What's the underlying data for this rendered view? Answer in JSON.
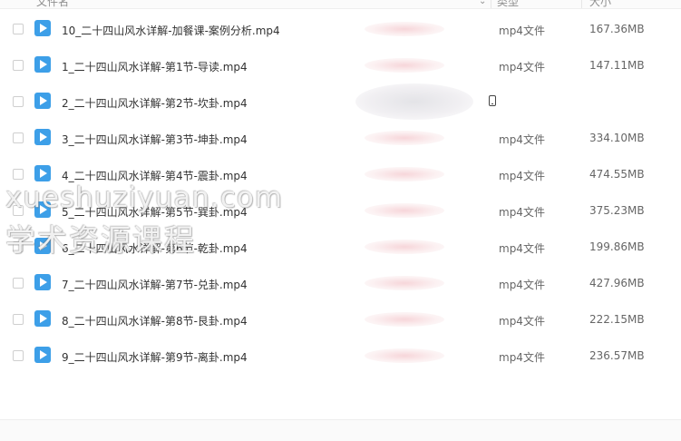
{
  "header": {
    "name_col": "文件名",
    "type_col": "类型",
    "size_col": "大小"
  },
  "files": [
    {
      "name": "10_二十四山风水详解-加餐课-案例分析.mp4",
      "type": "mp4文件",
      "size": "167.36MB"
    },
    {
      "name": "1_二十四山风水详解-第1节-导读.mp4",
      "type": "mp4文件",
      "size": "147.11MB"
    },
    {
      "name": "2_二十四山风水详解-第2节-坎卦.mp4",
      "type": "",
      "size": ""
    },
    {
      "name": "3_二十四山风水详解-第3节-坤卦.mp4",
      "type": "mp4文件",
      "size": "334.10MB"
    },
    {
      "name": "4_二十四山风水详解-第4节-震卦.mp4",
      "type": "mp4文件",
      "size": "474.55MB"
    },
    {
      "name": "5_二十四山风水详解-第5节-巽卦.mp4",
      "type": "mp4文件",
      "size": "375.23MB"
    },
    {
      "name": "6_二十四山风水详解-第6节-乾卦.mp4",
      "type": "mp4文件",
      "size": "199.86MB"
    },
    {
      "name": "7_二十四山风水详解-第7节-兑卦.mp4",
      "type": "mp4文件",
      "size": "427.96MB"
    },
    {
      "name": "8_二十四山风水详解-第8节-艮卦.mp4",
      "type": "mp4文件",
      "size": "222.15MB"
    },
    {
      "name": "9_二十四山风水详解-第9节-离卦.mp4",
      "type": "mp4文件",
      "size": "236.57MB"
    }
  ],
  "watermark": {
    "line1": "xueshuziyuan.com",
    "line2": "学术资源课程"
  },
  "icons": {
    "file": "video-file-icon",
    "row_action": "phone-icon",
    "sort": "chevron-down-icon"
  },
  "colors": {
    "file_icon": "#3d9fe8",
    "text": "#333333",
    "muted": "#666666"
  }
}
